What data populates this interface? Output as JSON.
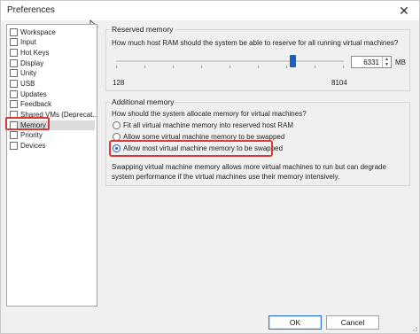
{
  "window": {
    "title": "Preferences"
  },
  "sidebar": {
    "items": [
      {
        "label": "Workspace",
        "icon": "workspace-icon"
      },
      {
        "label": "Input",
        "icon": "input-icon"
      },
      {
        "label": "Hot Keys",
        "icon": "hotkeys-icon"
      },
      {
        "label": "Display",
        "icon": "display-icon"
      },
      {
        "label": "Unity",
        "icon": "unity-icon"
      },
      {
        "label": "USB",
        "icon": "usb-icon"
      },
      {
        "label": "Updates",
        "icon": "updates-icon"
      },
      {
        "label": "Feedback",
        "icon": "feedback-icon"
      },
      {
        "label": "Shared VMs (Deprecat...",
        "icon": "shared-vms-icon"
      },
      {
        "label": "Memory",
        "icon": "memory-icon"
      },
      {
        "label": "Priority",
        "icon": "priority-icon"
      },
      {
        "label": "Devices",
        "icon": "devices-icon"
      }
    ],
    "selected": "Memory"
  },
  "reserved": {
    "title": "Reserved memory",
    "question": "How much host RAM should the system be able to reserve for all running virtual machines?",
    "min": "128",
    "max": "8104",
    "value": "6331",
    "unit": "MB",
    "slider_value": 6331
  },
  "additional": {
    "title": "Additional memory",
    "question": "How should the system allocate memory for virtual machines?",
    "options": [
      {
        "label": "Fit all virtual machine memory into reserved host RAM",
        "selected": false
      },
      {
        "label": "Allow some virtual machine memory to be swapped",
        "selected": false
      },
      {
        "label": "Allow most virtual machine memory to be swapped",
        "selected": true
      }
    ],
    "note": "Swapping virtual machine memory allows more virtual machines to run but can degrade system performance if the virtual machines use their memory intensively."
  },
  "buttons": {
    "ok": "OK",
    "cancel": "Cancel"
  },
  "colors": {
    "accent": "#1f5fbf",
    "highlight_box": "#d83a3a"
  }
}
